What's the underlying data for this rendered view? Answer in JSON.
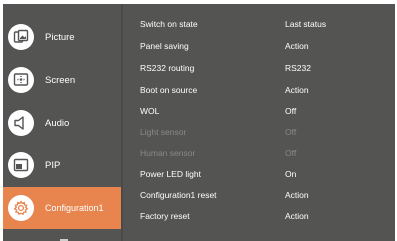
{
  "sidebar": {
    "items": [
      {
        "label": "Picture",
        "icon": "picture-icon"
      },
      {
        "label": "Screen",
        "icon": "screen-icon"
      },
      {
        "label": "Audio",
        "icon": "speaker-icon"
      },
      {
        "label": "PIP",
        "icon": "pip-icon"
      },
      {
        "label": "Configuration1",
        "icon": "gear-icon",
        "active": true
      }
    ]
  },
  "settings": {
    "rows": [
      {
        "name": "Switch on state",
        "value": "Last status"
      },
      {
        "name": "Panel saving",
        "value": "Action"
      },
      {
        "name": "RS232 routing",
        "value": "RS232"
      },
      {
        "name": "Boot on source",
        "value": "Action"
      },
      {
        "name": "WOL",
        "value": "Off"
      },
      {
        "name": "Light sensor",
        "value": "Off",
        "disabled": true
      },
      {
        "name": "Human sensor",
        "value": "Off",
        "disabled": true
      },
      {
        "name": "Power LED light",
        "value": "On"
      },
      {
        "name": "Configuration1 reset",
        "value": "Action"
      },
      {
        "name": "Factory reset",
        "value": "Action"
      }
    ]
  },
  "colors": {
    "panel_bg": "#545453",
    "active_accent": "#e8844d",
    "text": "#ffffff",
    "disabled_text": "#8a8a88"
  }
}
